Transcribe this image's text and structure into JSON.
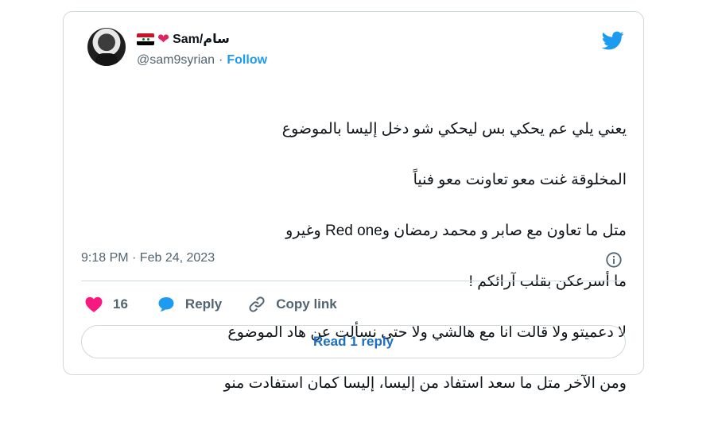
{
  "author": {
    "display_name": "Sam/سام",
    "handle": "@sam9syrian",
    "separator": "·",
    "follow_label": "Follow",
    "emoji_heart": "❤"
  },
  "tweet": {
    "lines": [
      "يعني يلي عم يحكي بس ليحكي شو دخل إليسا بالموضوع",
      "المخلوقة غنت معو تعاونت معو فنياً",
      "متل ما تعاون مع صابر و محمد رمضان وRed one وغيرو",
      "ما أسرعكن بقلب آرائكم !",
      "لا دعميتو ولا قالت انا مع هالشي ولا حتى نسألت عن هاد الموضوع",
      "ومن الآخر متل ما سعد استفاد من إليسا، إليسا كمان استفادت منو"
    ],
    "timestamp": "9:18 PM · Feb 24, 2023"
  },
  "actions": {
    "like_count": "16",
    "reply_label": "Reply",
    "copy_link_label": "Copy link"
  },
  "read_replies_label": "Read 1 reply",
  "colors": {
    "accent": "#1d9bf0",
    "heart": "#f91880",
    "muted": "#536471",
    "border": "#cfd9de"
  },
  "icons": [
    "twitter-bird-icon",
    "info-icon",
    "heart-icon",
    "reply-bubble-icon",
    "link-icon"
  ]
}
